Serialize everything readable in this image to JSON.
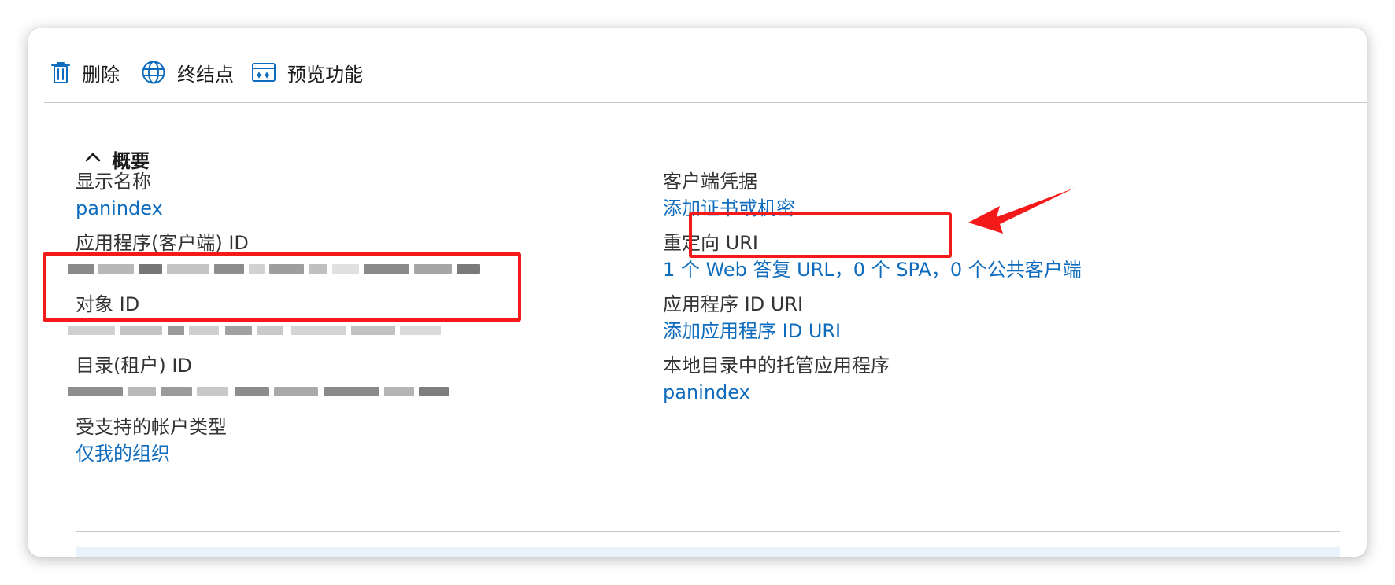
{
  "toolbar": {
    "items": [
      {
        "label": "删除",
        "icon": "trash-icon"
      },
      {
        "label": "终结点",
        "icon": "globe-icon"
      },
      {
        "label": "预览功能",
        "icon": "preview-features-icon"
      }
    ]
  },
  "overview": {
    "section_title": "概要",
    "left": {
      "display_name": {
        "label": "显示名称",
        "value": "panindex"
      },
      "client_id": {
        "label": "应用程序(客户端) ID"
      },
      "object_id": {
        "label": "对象 ID"
      },
      "tenant_id": {
        "label": "目录(租户) ID"
      },
      "account_types": {
        "label": "受支持的帐户类型",
        "value": "仅我的组织"
      }
    },
    "right": {
      "client_credentials": {
        "label": "客户端凭据",
        "value": "添加证书或机密"
      },
      "redirect_uri": {
        "label": "重定向 URI",
        "value": "1 个 Web 答复 URL，0 个 SPA，0 个公共客户端"
      },
      "app_id_uri": {
        "label": "应用程序 ID URI",
        "value": "添加应用程序 ID URI"
      },
      "managed_app": {
        "label": "本地目录中的托管应用程序",
        "value": "panindex"
      }
    }
  },
  "colors": {
    "link": "#0f6cbd",
    "icon": "#0f6cbd",
    "annotation": "#f51a1a"
  }
}
